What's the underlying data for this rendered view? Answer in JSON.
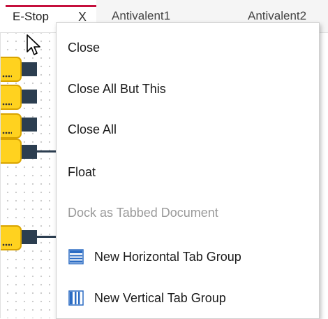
{
  "tabs": [
    {
      "label": "E-Stop",
      "close": "X",
      "active": true
    },
    {
      "label": "Antivalent1",
      "active": false
    },
    {
      "label": "Antivalent2",
      "active": false
    }
  ],
  "canvas": {
    "blocks": [
      {
        "label": "..."
      },
      {
        "label": "..."
      },
      {
        "label": "..."
      },
      {
        "label": "..."
      },
      {
        "label": "..."
      }
    ]
  },
  "context_menu": {
    "items": [
      {
        "label": "Close",
        "enabled": true
      },
      {
        "label": "Close All But This",
        "enabled": true
      },
      {
        "label": "Close All",
        "enabled": true
      },
      {
        "label": "Float",
        "enabled": true
      },
      {
        "label": "Dock as Tabbed Document",
        "enabled": false
      },
      {
        "label": "New Horizontal Tab Group",
        "enabled": true,
        "icon": "horizontal-tab-group-icon"
      },
      {
        "label": "New Vertical Tab Group",
        "enabled": true,
        "icon": "vertical-tab-group-icon"
      }
    ]
  },
  "colors": {
    "accent": "#c50f3c",
    "block_fill": "#ffd21f",
    "port": "#2c3e50",
    "icon_blue": "#2b6cc4"
  }
}
